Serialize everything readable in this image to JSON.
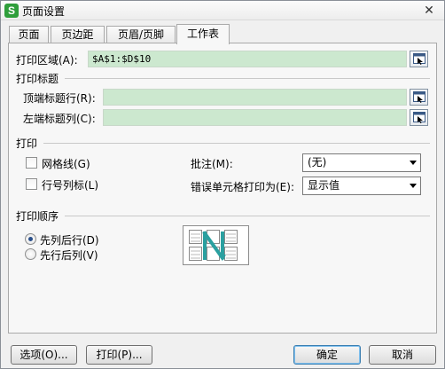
{
  "window": {
    "title": "页面设置",
    "app_icon_letter": "S",
    "close_glyph": "✕"
  },
  "tabs": [
    {
      "label": "页面"
    },
    {
      "label": "页边距"
    },
    {
      "label": "页眉/页脚"
    },
    {
      "label": "工作表",
      "active": true
    }
  ],
  "print_area": {
    "label": "打印区域(A):",
    "value": "$A$1:$D$10"
  },
  "print_titles": {
    "section_label": "打印标题",
    "top_rows_label": "顶端标题行(R):",
    "top_rows_value": "",
    "left_cols_label": "左端标题列(C):",
    "left_cols_value": ""
  },
  "print": {
    "section_label": "打印",
    "gridlines_label": "网格线(G)",
    "gridlines_checked": false,
    "row_col_headers_label": "行号列标(L)",
    "row_col_headers_checked": false,
    "comments_label": "批注(M):",
    "comments_value": "(无)",
    "cell_errors_label": "错误单元格打印为(E):",
    "cell_errors_value": "显示值"
  },
  "page_order": {
    "section_label": "打印顺序",
    "down_then_over_label": "先列后行(D)",
    "over_then_down_label": "先行后列(V)",
    "selected": "down_then_over"
  },
  "buttons": {
    "options": "选项(O)...",
    "print": "打印(P)...",
    "ok": "确定",
    "cancel": "取消"
  },
  "colors": {
    "field_fill": "#cce8cf",
    "preview_arrow": "#2aa0a0",
    "app_icon": "#2f9e3b"
  }
}
